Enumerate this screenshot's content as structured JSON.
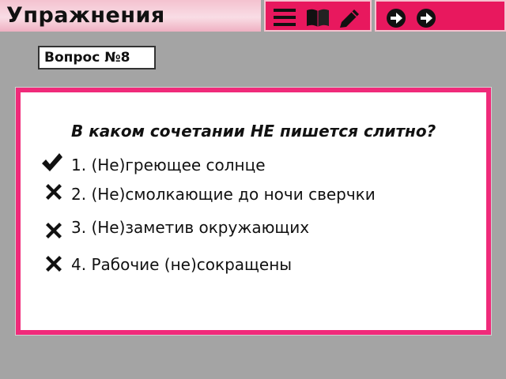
{
  "header": {
    "title": "Упражнения",
    "tools_icons": [
      "menu-lines-icon",
      "book-icon",
      "pencil-icon"
    ],
    "nav_icons": [
      "arrow-right-icon",
      "arrow-right-icon"
    ]
  },
  "question_label": "Вопрос №8",
  "question": {
    "text": "В каком сочетании НЕ пишется слитно?",
    "options": [
      {
        "label": "1. (Не)греющее солнце",
        "mark": "check-icon"
      },
      {
        "label": "2. (Не)смолкающие до ночи сверчки",
        "mark": "cross-icon"
      },
      {
        "label": "3. (Не)заметив окружающих",
        "mark": "cross-icon"
      },
      {
        "label": "4. Рабочие (не)сокращены",
        "mark": "cross-icon"
      }
    ]
  },
  "colors": {
    "accent": "#e8185e",
    "card_border": "#f02a7a",
    "title_panel": "#f4c2cf",
    "background": "#a4a4a4"
  }
}
